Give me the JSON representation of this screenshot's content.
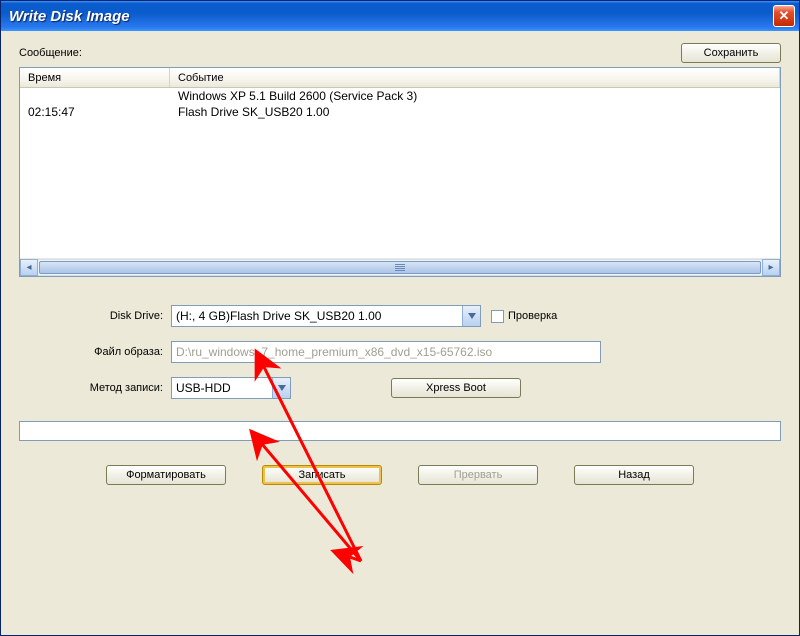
{
  "window": {
    "title": "Write Disk Image"
  },
  "labels": {
    "message": "Сообщение:",
    "save": "Сохранить",
    "col_time": "Время",
    "col_event": "Событие",
    "disk_drive": "Disk Drive:",
    "image_file": "Файл образа:",
    "write_method": "Метод записи:",
    "verify": "Проверка",
    "xpress_boot": "Xpress Boot",
    "format": "Форматировать",
    "write": "Записать",
    "abort": "Прервать",
    "back": "Назад"
  },
  "log": {
    "rows": [
      {
        "time": "",
        "event": "Windows XP 5.1 Build 2600 (Service Pack 3)"
      },
      {
        "time": "02:15:47",
        "event": "Flash   Drive SK_USB20  1.00"
      }
    ]
  },
  "fields": {
    "disk_drive_value": "(H:, 4 GB)Flash   Drive SK_USB20  1.00",
    "image_file_value": "D:\\ru_windows_7_home_premium_x86_dvd_x15-65762.iso",
    "write_method_value": "USB-HDD"
  }
}
